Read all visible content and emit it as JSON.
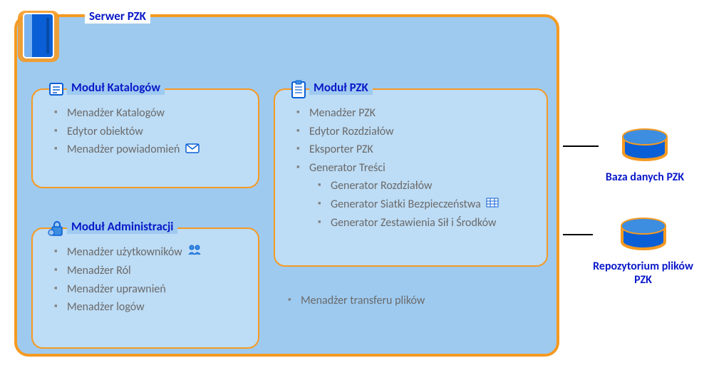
{
  "server": {
    "title": "Serwer PZK"
  },
  "modules": {
    "catalogs": {
      "title": "Moduł Katalogów",
      "items": [
        "Menadżer Katalogów",
        "Edytor obiektów",
        "Menadżer powiadomień"
      ]
    },
    "admin": {
      "title": "Moduł Administracji",
      "items": [
        "Menadżer użytkowników",
        "Menadżer Ról",
        "Menadżer uprawnień",
        "Menadżer logów"
      ]
    },
    "pzk": {
      "title": "Moduł PZK",
      "items": [
        "Menadżer PZK",
        "Edytor Rozdziałów",
        "Eksporter PZK",
        "Generator Treści"
      ],
      "subitems": [
        "Generator Rozdziałów",
        "Generator Siatki Bezpieczeństwa",
        "Generator Zestawienia Sił i Środków"
      ]
    }
  },
  "file_transfer": "Menadżer transferu plików",
  "db": {
    "label": "Baza danych PZK"
  },
  "repo": {
    "label": "Repozytorium plików PZK"
  }
}
